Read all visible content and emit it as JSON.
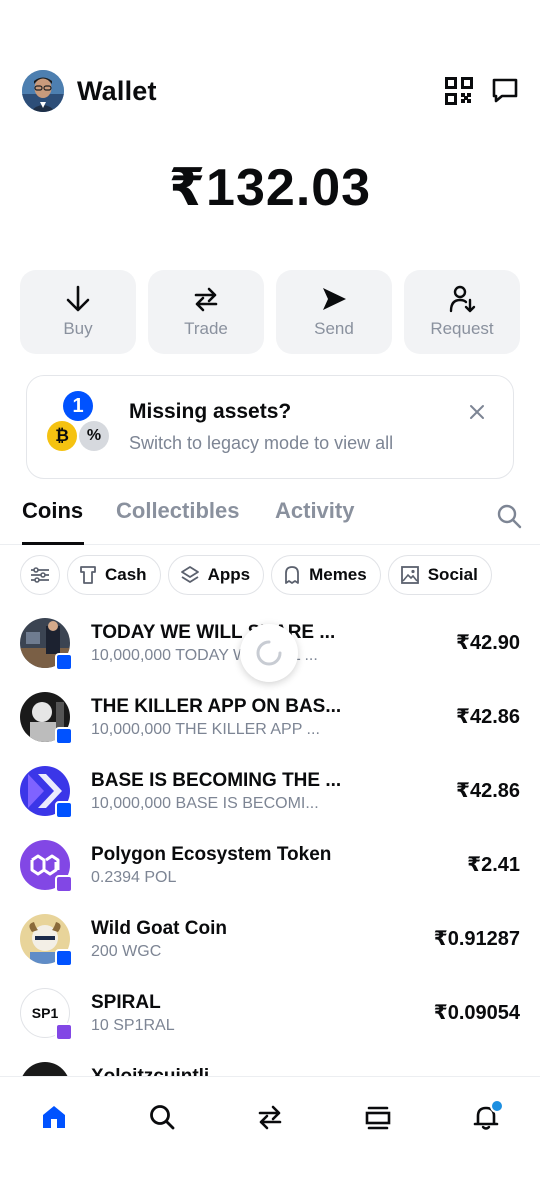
{
  "header": {
    "title": "Wallet",
    "avatar_icon": "user-avatar",
    "qr_icon": "qr-code-icon",
    "chat_icon": "message-icon"
  },
  "balance": "₹132.03",
  "actions": [
    {
      "label": "Buy",
      "icon": "arrow-down-icon"
    },
    {
      "label": "Trade",
      "icon": "swap-icon"
    },
    {
      "label": "Send",
      "icon": "send-icon"
    },
    {
      "label": "Request",
      "icon": "request-icon"
    }
  ],
  "banner": {
    "title": "Missing assets?",
    "subtitle": "Switch to legacy mode to view all",
    "badge_one": "1",
    "badge_percent": "%",
    "badge_btc": "₿"
  },
  "tabs": [
    {
      "label": "Coins",
      "active": true
    },
    {
      "label": "Collectibles",
      "active": false
    },
    {
      "label": "Activity",
      "active": false
    }
  ],
  "chips": [
    {
      "label": "Cash",
      "icon": "cash-icon"
    },
    {
      "label": "Apps",
      "icon": "layers-icon"
    },
    {
      "label": "Memes",
      "icon": "ghost-icon"
    },
    {
      "label": "Social",
      "icon": "image-icon"
    }
  ],
  "coins": [
    {
      "name": "TODAY WE WILL SHARE ...",
      "sub": "10,000,000 TODAY WE WILL ...",
      "value": "₹42.90",
      "network": "base"
    },
    {
      "name": "THE KILLER APP ON BAS...",
      "sub": "10,000,000 THE KILLER APP ...",
      "value": "₹42.86",
      "network": "base"
    },
    {
      "name": "BASE IS BECOMING THE ...",
      "sub": "10,000,000 BASE IS BECOMI...",
      "value": "₹42.86",
      "network": "base"
    },
    {
      "name": "Polygon Ecosystem Token",
      "sub": "0.2394 POL",
      "value": "₹2.41",
      "network": "polygon"
    },
    {
      "name": "Wild Goat Coin",
      "sub": "200 WGC",
      "value": "₹0.91287",
      "network": "base"
    },
    {
      "name": "SPIRAL",
      "sub": "10 SP1RAL",
      "value": "₹0.09054",
      "network": "polygon",
      "icon_text": "SP1"
    },
    {
      "name": "Xoloitzcuintli",
      "sub": "",
      "value": "",
      "network": "base"
    }
  ],
  "colors": {
    "base_blue": "#0052ff",
    "polygon_purple": "#8247e5",
    "primary_blue": "#0052ff",
    "notification": "#1d8fe1"
  },
  "nav": [
    "home-icon",
    "search-icon",
    "swap-icon",
    "stack-icon",
    "bell-icon"
  ]
}
